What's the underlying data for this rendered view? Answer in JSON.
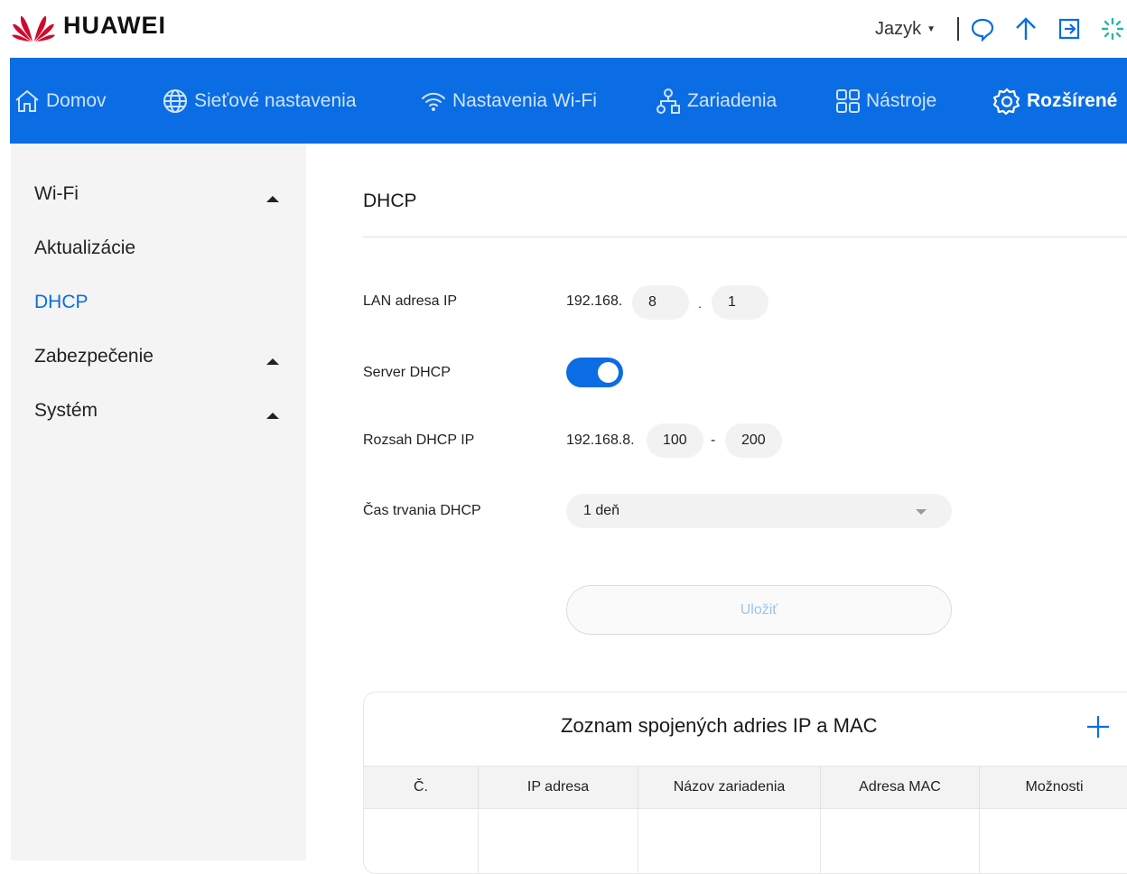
{
  "brand": {
    "name": "HUAWEI",
    "color": "#cf0a2c"
  },
  "header": {
    "language_label": "Jazyk",
    "icons": [
      "chat-icon",
      "upload-icon",
      "logout-icon",
      "loading-icon"
    ]
  },
  "nav": {
    "accent": "#0a6de3",
    "items": [
      {
        "label": "Domov",
        "icon": "home-icon"
      },
      {
        "label": "Sieťové nastavenia",
        "icon": "globe-icon"
      },
      {
        "label": "Nastavenia Wi-Fi",
        "icon": "wifi-icon"
      },
      {
        "label": "Zariadenia",
        "icon": "devices-icon"
      },
      {
        "label": "Nástroje",
        "icon": "tools-icon"
      },
      {
        "label": "Rozšírené",
        "icon": "gear-icon",
        "active": true
      }
    ]
  },
  "sidebar": {
    "items": [
      {
        "label": "Wi-Fi",
        "expandable": true
      },
      {
        "label": "Aktualizácie"
      },
      {
        "label": "DHCP",
        "active": true
      },
      {
        "label": "Zabezpečenie",
        "expandable": true
      },
      {
        "label": "Systém",
        "expandable": true
      }
    ]
  },
  "page": {
    "title": "DHCP",
    "lan_ip": {
      "label": "LAN adresa IP",
      "prefix": "192.168.",
      "octet3": "8",
      "separator": ".",
      "octet4": "1"
    },
    "dhcp_server": {
      "label": "Server DHCP",
      "enabled": true
    },
    "dhcp_range": {
      "label": "Rozsah DHCP IP",
      "prefix": "192.168.8.",
      "start": "100",
      "separator": "-",
      "end": "200"
    },
    "lease_time": {
      "label": "Čas trvania DHCP",
      "value": "1 deň"
    },
    "save_label": "Uložiť"
  },
  "binding_table": {
    "title": "Zoznam spojených adries IP a MAC",
    "columns": [
      "Č.",
      "IP adresa",
      "Názov zariadenia",
      "Adresa MAC",
      "Možnosti"
    ],
    "rows": []
  }
}
